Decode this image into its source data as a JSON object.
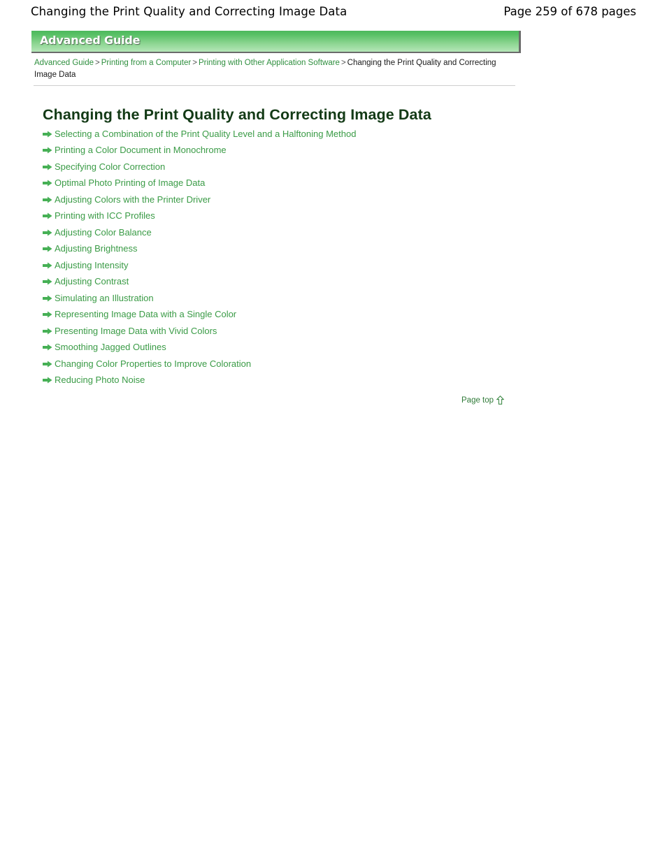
{
  "page_header": {
    "title": "Changing the Print Quality and Correcting Image Data",
    "page_number": "Page 259 of 678 pages"
  },
  "banner": {
    "label": "Advanced Guide",
    "gradient_top": "#4cb85c",
    "gradient_bottom": "#b5e6b8",
    "border_color": "#6b6b6b"
  },
  "breadcrumb": {
    "items": [
      {
        "label": "Advanced Guide",
        "is_link": true
      },
      {
        "label": "Printing from a Computer",
        "is_link": true
      },
      {
        "label": "Printing with Other Application Software",
        "is_link": true
      },
      {
        "label": "Changing the Print Quality and Correcting Image Data",
        "is_link": false
      }
    ],
    "separator": ">"
  },
  "doc_title": "Changing the Print Quality and Correcting Image Data",
  "link_list": {
    "bullet_icon": "right-arrow-icon",
    "link_color": "#3a9b46",
    "items": [
      {
        "label": "Selecting a Combination of the Print Quality Level and a Halftoning Method"
      },
      {
        "label": "Printing a Color Document in Monochrome"
      },
      {
        "label": "Specifying Color Correction"
      },
      {
        "label": "Optimal Photo Printing of Image Data"
      },
      {
        "label": "Adjusting Colors with the Printer Driver"
      },
      {
        "label": "Printing with ICC Profiles"
      },
      {
        "label": "Adjusting Color Balance"
      },
      {
        "label": "Adjusting Brightness"
      },
      {
        "label": "Adjusting Intensity"
      },
      {
        "label": "Adjusting Contrast"
      },
      {
        "label": "Simulating an Illustration"
      },
      {
        "label": "Representing Image Data with a Single Color"
      },
      {
        "label": "Presenting Image Data with Vivid Colors"
      },
      {
        "label": "Smoothing Jagged Outlines"
      },
      {
        "label": "Changing Color Properties to Improve Coloration"
      },
      {
        "label": "Reducing Photo Noise"
      }
    ]
  },
  "page_top": {
    "label": "Page top",
    "icon": "up-arrow-icon"
  }
}
